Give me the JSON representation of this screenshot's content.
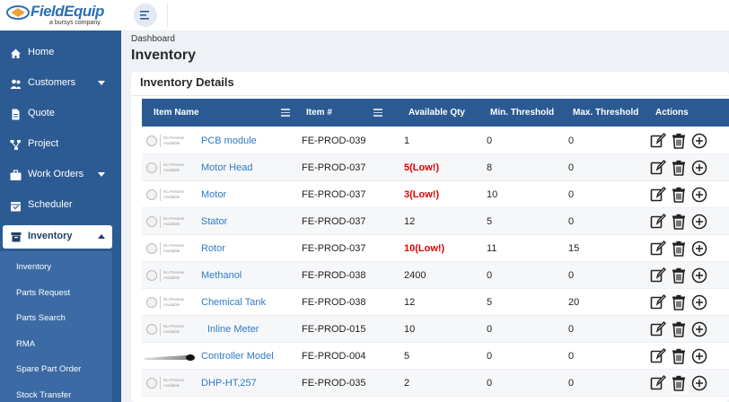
{
  "app": {
    "logo_text": "FieldEquip",
    "logo_sub": "a bursys company"
  },
  "sidebar": {
    "items": [
      {
        "label": "Home",
        "icon": "home-icon"
      },
      {
        "label": "Customers",
        "icon": "users-icon",
        "has_caret": true
      },
      {
        "label": "Quote",
        "icon": "document-icon"
      },
      {
        "label": "Project",
        "icon": "project-icon"
      },
      {
        "label": "Work Orders",
        "icon": "briefcase-icon",
        "has_caret": true
      },
      {
        "label": "Scheduler",
        "icon": "calendar-icon"
      }
    ],
    "active": {
      "label": "Inventory",
      "icon": "inventory-icon"
    },
    "sub_items": [
      "Inventory",
      "Parts Request",
      "Parts Search",
      "RMA",
      "Spare Part Order",
      "Stock Transfer"
    ]
  },
  "page": {
    "breadcrumb": "Dashboard",
    "title": "Inventory",
    "card_title": "Inventory Details"
  },
  "table": {
    "columns": [
      "Item Name",
      "Item #",
      "Available Qty",
      "Min. Threshold",
      "Max. Threshold",
      "Actions"
    ],
    "rows": [
      {
        "name": "PCB module",
        "item_no": "FE-PROD-039",
        "qty": "1",
        "min": "0",
        "max": "0",
        "low": false,
        "thumb": "placeholder"
      },
      {
        "name": "Motor Head",
        "item_no": "FE-PROD-037",
        "qty": "5(Low!)",
        "min": "8",
        "max": "0",
        "low": true,
        "thumb": "placeholder"
      },
      {
        "name": "Motor",
        "item_no": "FE-PROD-037",
        "qty": "3(Low!)",
        "min": "10",
        "max": "0",
        "low": true,
        "thumb": "placeholder"
      },
      {
        "name": "Stator",
        "item_no": "FE-PROD-037",
        "qty": "12",
        "min": "5",
        "max": "0",
        "low": false,
        "thumb": "placeholder"
      },
      {
        "name": "Rotor",
        "item_no": "FE-PROD-037",
        "qty": "10(Low!)",
        "min": "11",
        "max": "15",
        "low": true,
        "thumb": "placeholder"
      },
      {
        "name": "Methanol",
        "item_no": "FE-PROD-038",
        "qty": "2400",
        "min": "0",
        "max": "0",
        "low": false,
        "thumb": "placeholder"
      },
      {
        "name": "Chemical Tank",
        "item_no": "FE-PROD-038",
        "qty": "12",
        "min": "5",
        "max": "20",
        "low": false,
        "thumb": "placeholder"
      },
      {
        "name": "Inline Meter",
        "item_no": "FE-PROD-015",
        "qty": "10",
        "min": "0",
        "max": "0",
        "low": false,
        "thumb": "placeholder"
      },
      {
        "name": "Controller Model",
        "item_no": "FE-PROD-004",
        "qty": "5",
        "min": "0",
        "max": "0",
        "low": false,
        "thumb": "image"
      },
      {
        "name": "DHP-HT,257",
        "item_no": "FE-PROD-035",
        "qty": "2",
        "min": "0",
        "max": "0",
        "low": false,
        "thumb": "placeholder"
      }
    ],
    "placeholder_text": [
      "No Preview",
      "Available"
    ]
  },
  "colors": {
    "sidebar": "#2c5b93",
    "header": "#2b5a92",
    "link": "#2f7ac3",
    "low": "#e00000"
  }
}
